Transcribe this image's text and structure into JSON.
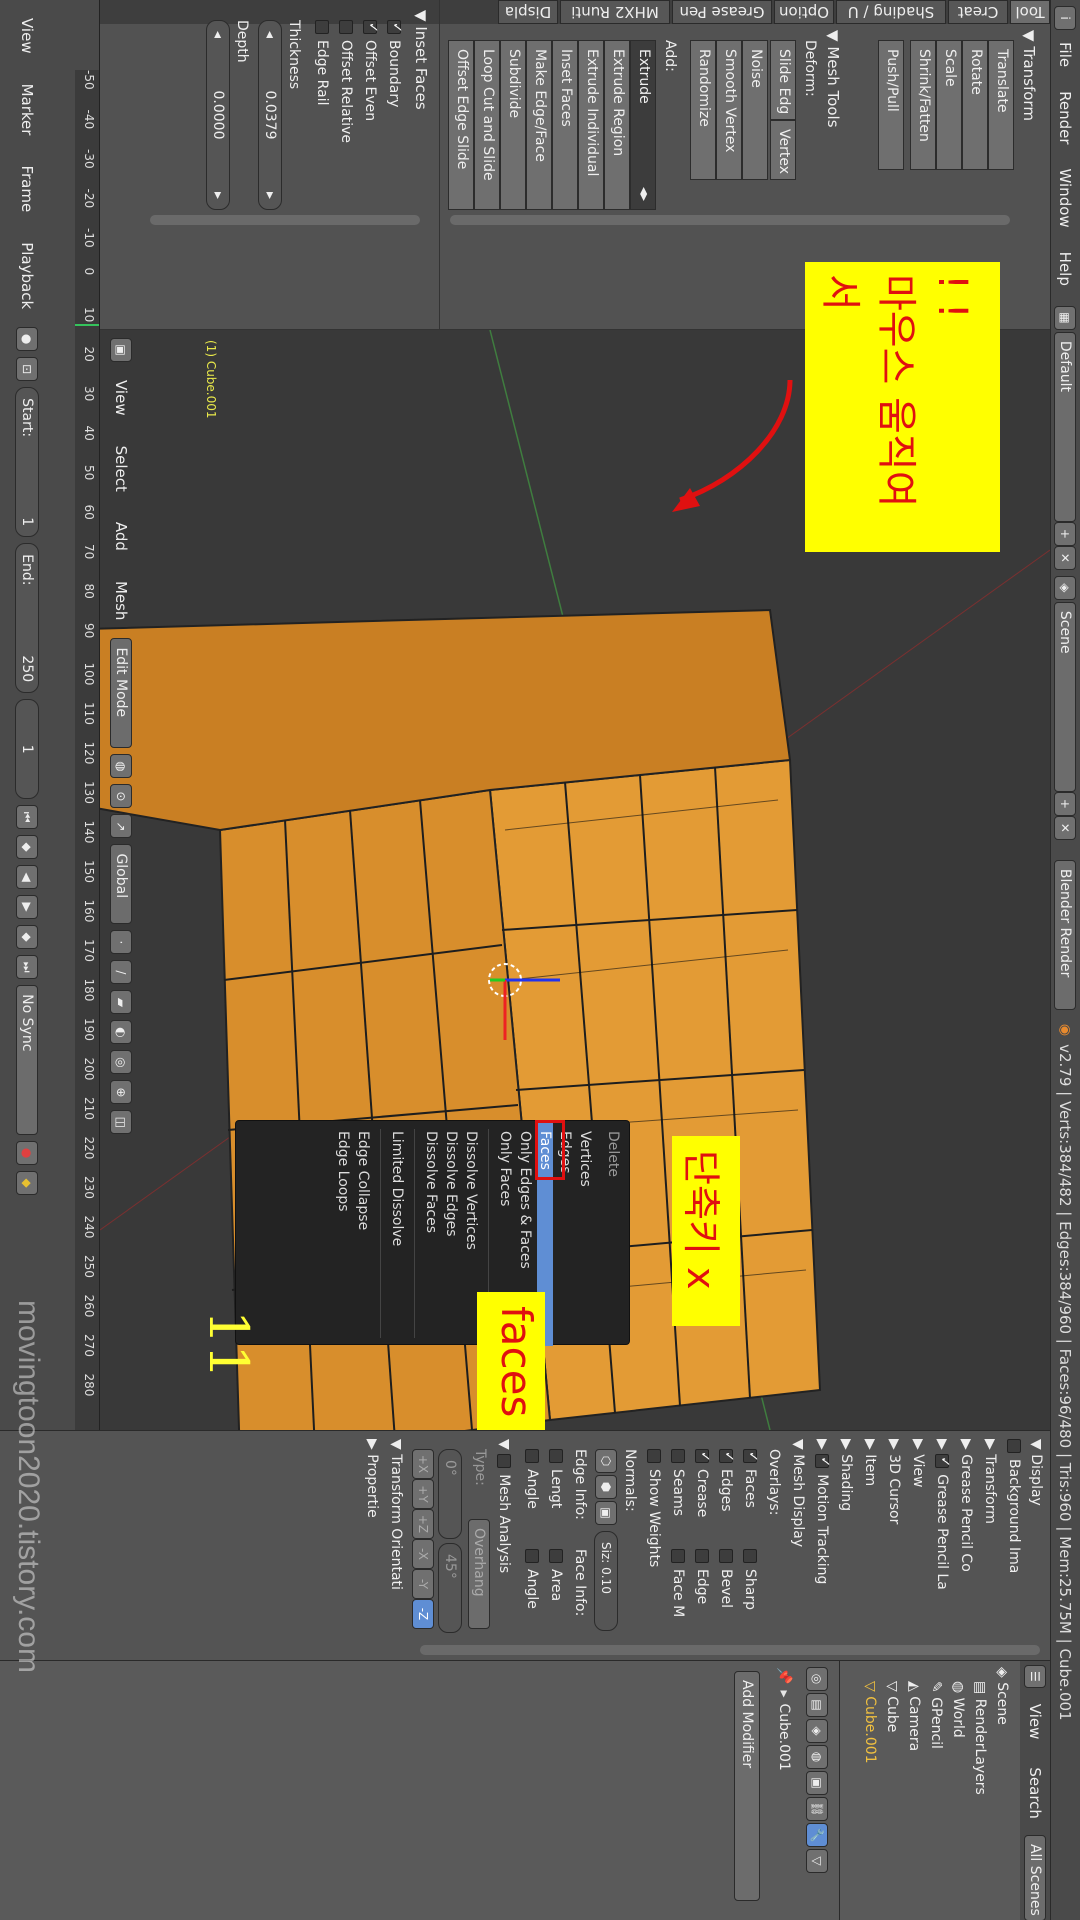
{
  "menubar": {
    "info_icon": "info-icon",
    "items": [
      "File",
      "Render",
      "Window",
      "Help"
    ],
    "layout": "Default",
    "scene": "Scene",
    "engine": "Blender Render",
    "status": "v2.79 | Verts:384/482 | Edges:384/960 | Faces:96/480 | Tris:960 | Mem:25.75M | Cube.001"
  },
  "tool_tabs": [
    "Tool",
    "Creat",
    "Shading / U",
    "Option",
    "Grease Pen",
    "MHX2 Runti",
    "Displa"
  ],
  "tool_shelf": {
    "transform": {
      "title": "Transform",
      "buttons": [
        "Translate",
        "Rotate",
        "Scale",
        "Shrink/Fatten",
        "Push/Pull"
      ]
    },
    "mesh_tools": {
      "title": "Mesh Tools",
      "deform_label": "Deform:",
      "deform_row": [
        "Slide Edg",
        "Vertex"
      ],
      "deform_buttons": [
        "Noise",
        "Smooth Vertex",
        "Randomize"
      ],
      "add_label": "Add:",
      "extrude": "Extrude",
      "add_buttons": [
        "Extrude Region",
        "Extrude Individual",
        "Inset Faces",
        "Make Edge/Face",
        "Subdivide",
        "Loop Cut and Slide",
        "Offset Edge Slide"
      ]
    }
  },
  "inset_panel": {
    "title": "Inset Faces",
    "checks": [
      {
        "label": "Boundary",
        "on": true
      },
      {
        "label": "Offset Even",
        "on": true
      },
      {
        "label": "Offset Relative",
        "on": false
      },
      {
        "label": "Edge Rail",
        "on": false
      }
    ],
    "thickness_label": "Thickness",
    "thickness_value": "0.0379",
    "depth_label": "Depth",
    "depth_value": "0.0000"
  },
  "viewport": {
    "object_label": "(1) Cube.001",
    "header_menus": [
      "View",
      "Select",
      "Add",
      "Mesh"
    ],
    "mode": "Edit Mode",
    "orientation": "Global"
  },
  "delete_menu": {
    "title": "Delete",
    "items": [
      "Vertices",
      "Edges",
      "Faces",
      "Only Edges & Faces",
      "Only Faces",
      "Dissolve Vertices",
      "Dissolve Edges",
      "Dissolve Faces",
      "Limited Dissolve",
      "Edge Collapse",
      "Edge Loops"
    ],
    "highlighted": "Faces"
  },
  "annotations": {
    "mouse_move": "마우스 움직여서",
    "exclaim": "!  !",
    "shortcut": "단축키 x",
    "faces": "faces",
    "step_number": "11",
    "arrow_color": "#e01010",
    "note_bg": "#ffff00"
  },
  "timeline": {
    "ruler_ticks": [
      "-50",
      "-40",
      "-30",
      "-20",
      "-10",
      "0",
      "10",
      "20",
      "30",
      "40",
      "50",
      "60",
      "70",
      "80",
      "90",
      "100",
      "110",
      "120",
      "130",
      "140",
      "150",
      "160",
      "170",
      "180",
      "190",
      "200",
      "210",
      "220",
      "230",
      "240",
      "250",
      "260",
      "270",
      "280"
    ],
    "menus": [
      "View",
      "Marker",
      "Frame",
      "Playback"
    ],
    "start_label": "Start:",
    "start_value": "1",
    "end_label": "End:",
    "end_value": "250",
    "current_frame": "1",
    "sync": "No Sync"
  },
  "properties": {
    "sections": [
      "Transform",
      "Grease Pencil Co",
      "Grease Pencil La",
      "View",
      "3D Cursor",
      "Item",
      "Shading",
      "Motion Tracking",
      "Mesh Display"
    ],
    "display": "Display",
    "background": "Background Ima",
    "overlays_label": "Overlays:",
    "overlay_checks": [
      [
        "Faces",
        "Sharp"
      ],
      [
        "Edges",
        "Bevel"
      ],
      [
        "Crease",
        "Edge"
      ],
      [
        "Seams",
        "Face M"
      ]
    ],
    "show_weights": "Show Weights",
    "normals_label": "Normals:",
    "normal_size": "Siz: 0.10",
    "edge_info": "Edge Info:",
    "face_info": "Face Info:",
    "info_checks": [
      [
        "Lengt",
        "Area"
      ],
      [
        "Angle",
        "Angle"
      ]
    ],
    "mesh_analysis": "Mesh Analysis",
    "type_label": "Type:",
    "type_value": "Overhang",
    "deg_min": "0°",
    "deg_max": "45°",
    "axes": [
      "+X",
      "+Y",
      "+Z",
      "-X",
      "-Y",
      "-Z"
    ],
    "transform_orient": "Transform Orientati",
    "properties_hdr": "Propertie"
  },
  "outliner": {
    "menus": [
      "View",
      "Search"
    ],
    "filter": "All Scenes",
    "tree": [
      "Scene",
      "RenderLayers",
      "World",
      "GPencil",
      "Camera",
      "Cube",
      "Cube.001"
    ],
    "object_name": "Cube.001",
    "add_modifier": "Add Modifier"
  },
  "watermark": "movingtoon2020.tistory.com"
}
